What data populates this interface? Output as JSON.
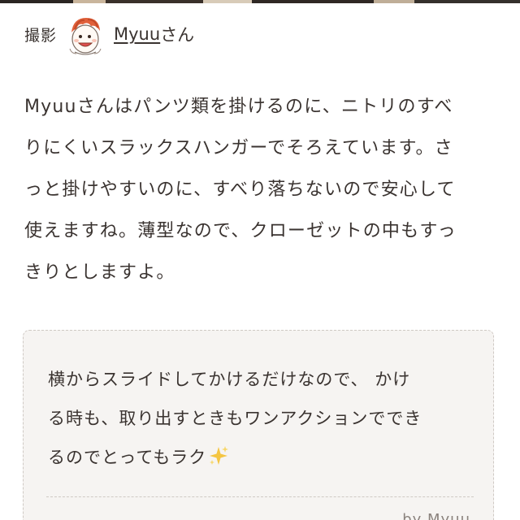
{
  "photo_credit": {
    "label": "撮影",
    "author_name": "Myuu",
    "author_suffix": "さん",
    "avatar_icon": "cartoon-avatar-icon"
  },
  "article": {
    "paragraph_lines": [
      "Myuuさんはパンツ類を掛けるのに、ニトリのすべ",
      "りにくいスラックスハンガーでそろえています。さ",
      "っと掛けやすいのに、すべり落ちないので安心して",
      "使えますね。薄型なので、クローゼットの中もすっ",
      "きりとしますよ。"
    ]
  },
  "quote": {
    "lines": [
      "横からスライドしてかけるだけなので、 かけ",
      "る時も、取り出すときもワンアクションででき",
      "るのでとってもラク"
    ],
    "emoji_icon": "sparkles-icon",
    "attribution": "by Myuu"
  },
  "colors": {
    "text": "#3a3330",
    "quote_bg": "#f6f4f2",
    "quote_border": "#cfc9c4",
    "attribution": "#8a827d",
    "sparkle": "#f4c542"
  }
}
